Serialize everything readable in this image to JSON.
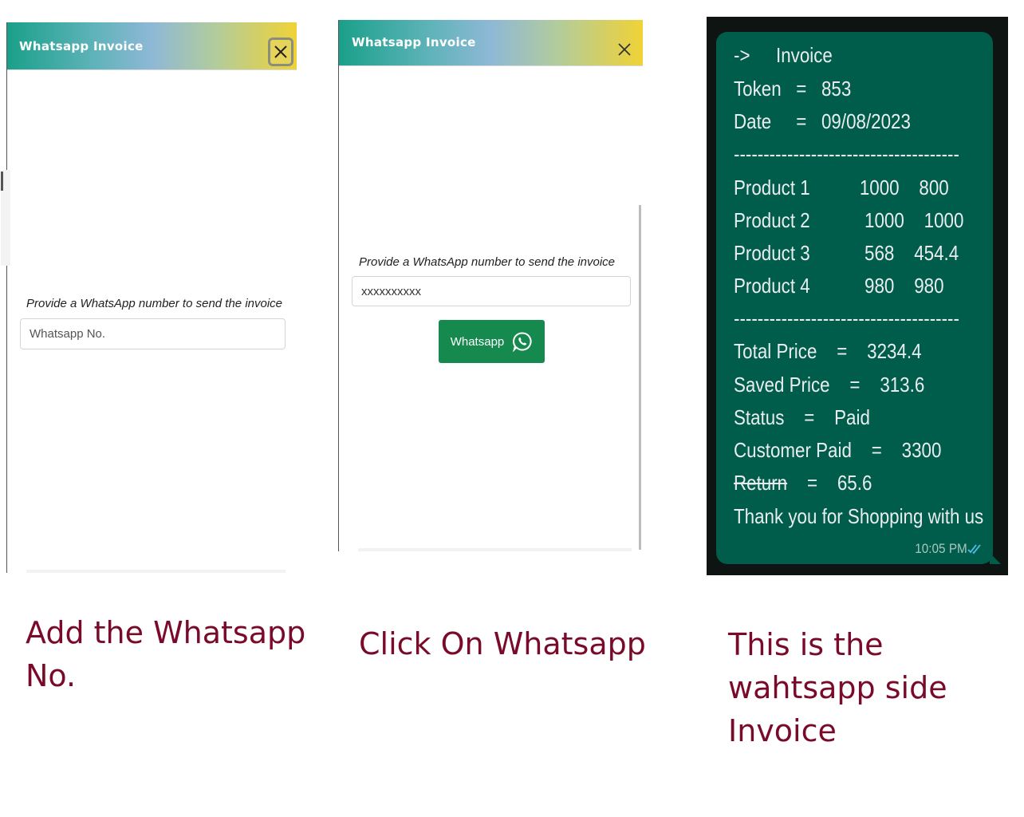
{
  "panel1": {
    "title": "Whatsapp Invoice",
    "prompt": "Provide a WhatsApp number to send the invoice",
    "input_placeholder": "Whatsapp No.",
    "input_value": ""
  },
  "panel2": {
    "title": "Whatsapp Invoice",
    "prompt": "Provide a WhatsApp number to send the invoice",
    "input_value": "xxxxxxxxxx",
    "button_label": "Whatsapp"
  },
  "chat": {
    "header_arrow": "->",
    "header_title": "Invoice",
    "token": "Token   =   853",
    "date": "Date     =   09/08/2023",
    "separator": "--------------------------------------",
    "products": [
      "Product 1          1000    800",
      "Product 2           1000    1000",
      "Product 3           568    454.4",
      "Product 4           980    980"
    ],
    "total_price": "Total Price    =    3234.4",
    "saved_price": "Saved Price    =    313.6",
    "status": "Status    =    Paid",
    "customer_paid": "Customer Paid    =    3300",
    "return_label": "Return",
    "return_value": "    =    65.6",
    "thanks": "Thank you for Shopping with us",
    "time": "10:05 PM"
  },
  "captions": {
    "caption1": "Add the Whatsapp No.",
    "caption2": "Click On Whatsapp",
    "caption3": "This is the wahtsapp side Invoice"
  },
  "colors": {
    "whatsapp_green": "#168a4e",
    "bubble": "#005c4b",
    "caption": "#7a0a2a",
    "read_ticks": "#53bdeb"
  }
}
